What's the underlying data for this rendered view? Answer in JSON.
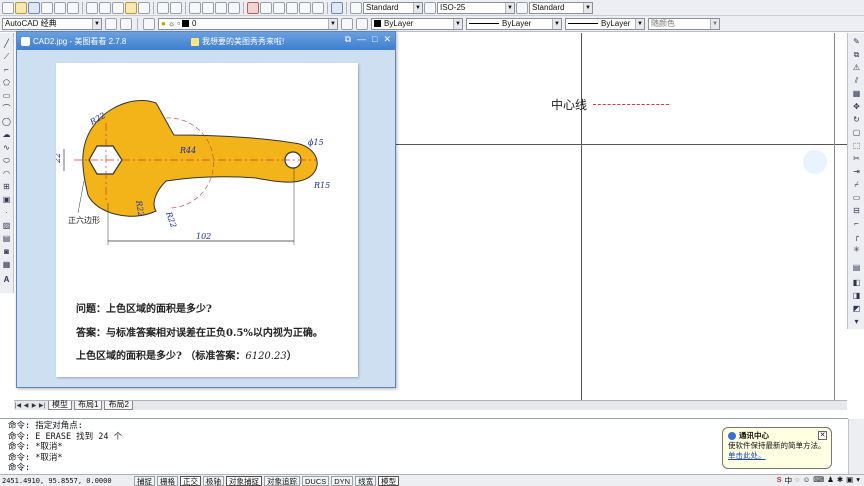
{
  "toolbar": {
    "workspace": "AutoCAD 经典",
    "layer": "0",
    "text_style": "Standard",
    "dim_style": "ISO-25",
    "table_style": "Standard",
    "color": "ByLayer",
    "linetype": "ByLayer",
    "lineweight": "ByLayer",
    "plot_style": "随颜色"
  },
  "drawing": {
    "center_line_label": "中心线"
  },
  "viewer": {
    "title": "CAD2.jpg - 美图看看 2.7.8",
    "promo": "我想要的美图秀秀来啦!",
    "figure_labels": {
      "r22_top": "R22",
      "r44": "R44",
      "phi15": "ϕ15",
      "r15": "R15",
      "r22_mid": "R22",
      "r22_bottom": "R22",
      "dim_left": "22",
      "dim_bottom": "102",
      "hexagon": "正六边形"
    },
    "question": "问题：上色区域的面积是多少?",
    "answer_rule": "答案：与标准答案相对误差在正负0.5%以内视为正确。",
    "answer_prefix": "上色区域的面积是多少? （标准答案：",
    "answer_value": "6120.23",
    "answer_suffix": "）"
  },
  "tabs": [
    "模型",
    "布局1",
    "布局2"
  ],
  "command_lines": [
    "命令: 指定对角点:",
    "命令: E ERASE 找到 24 个",
    "命令: *取消*",
    "命令: *取消*",
    "命令:"
  ],
  "bubble": {
    "title": "通讯中心",
    "text": "使软件保持最新的简单方法。",
    "link": "单击此处。"
  },
  "status": {
    "coords": "2451.4910, 95.8557, 0.0000",
    "buttons": [
      "捕捉",
      "栅格",
      "正交",
      "极轴",
      "对象捕捉",
      "对象追踪",
      "DUCS",
      "DYN",
      "线宽",
      "模型"
    ]
  },
  "colors": {
    "part_fill": "#f2b419",
    "center_dash": "#d43a3a",
    "viewer_title": "#3f7fcf"
  }
}
